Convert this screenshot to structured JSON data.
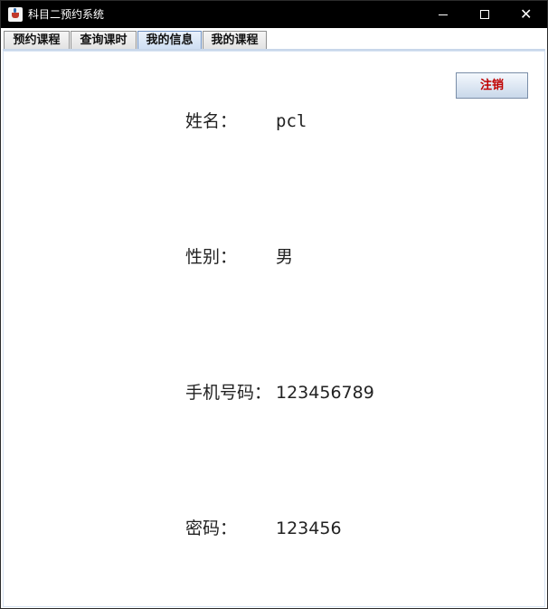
{
  "window": {
    "title": "科目二预约系统"
  },
  "tabs": [
    {
      "label": "预约课程"
    },
    {
      "label": "查询课时"
    },
    {
      "label": "我的信息"
    },
    {
      "label": "我的课程"
    }
  ],
  "active_tab": "我的信息",
  "logout_button": {
    "label": "注销"
  },
  "profile": {
    "name": {
      "label": "姓名：",
      "value": "pcl"
    },
    "gender": {
      "label": "性别：",
      "value": "男"
    },
    "phone": {
      "label": "手机号码：",
      "value": "123456789"
    },
    "password": {
      "label": "密码：",
      "value": "123456"
    }
  },
  "colors": {
    "titlebar": "#000000",
    "logout_text": "#c00000",
    "active_tab": "#cfdff3"
  },
  "icons": {
    "app": "java-icon",
    "minimize": "minimize-icon",
    "maximize": "maximize-icon",
    "close": "close-icon"
  }
}
